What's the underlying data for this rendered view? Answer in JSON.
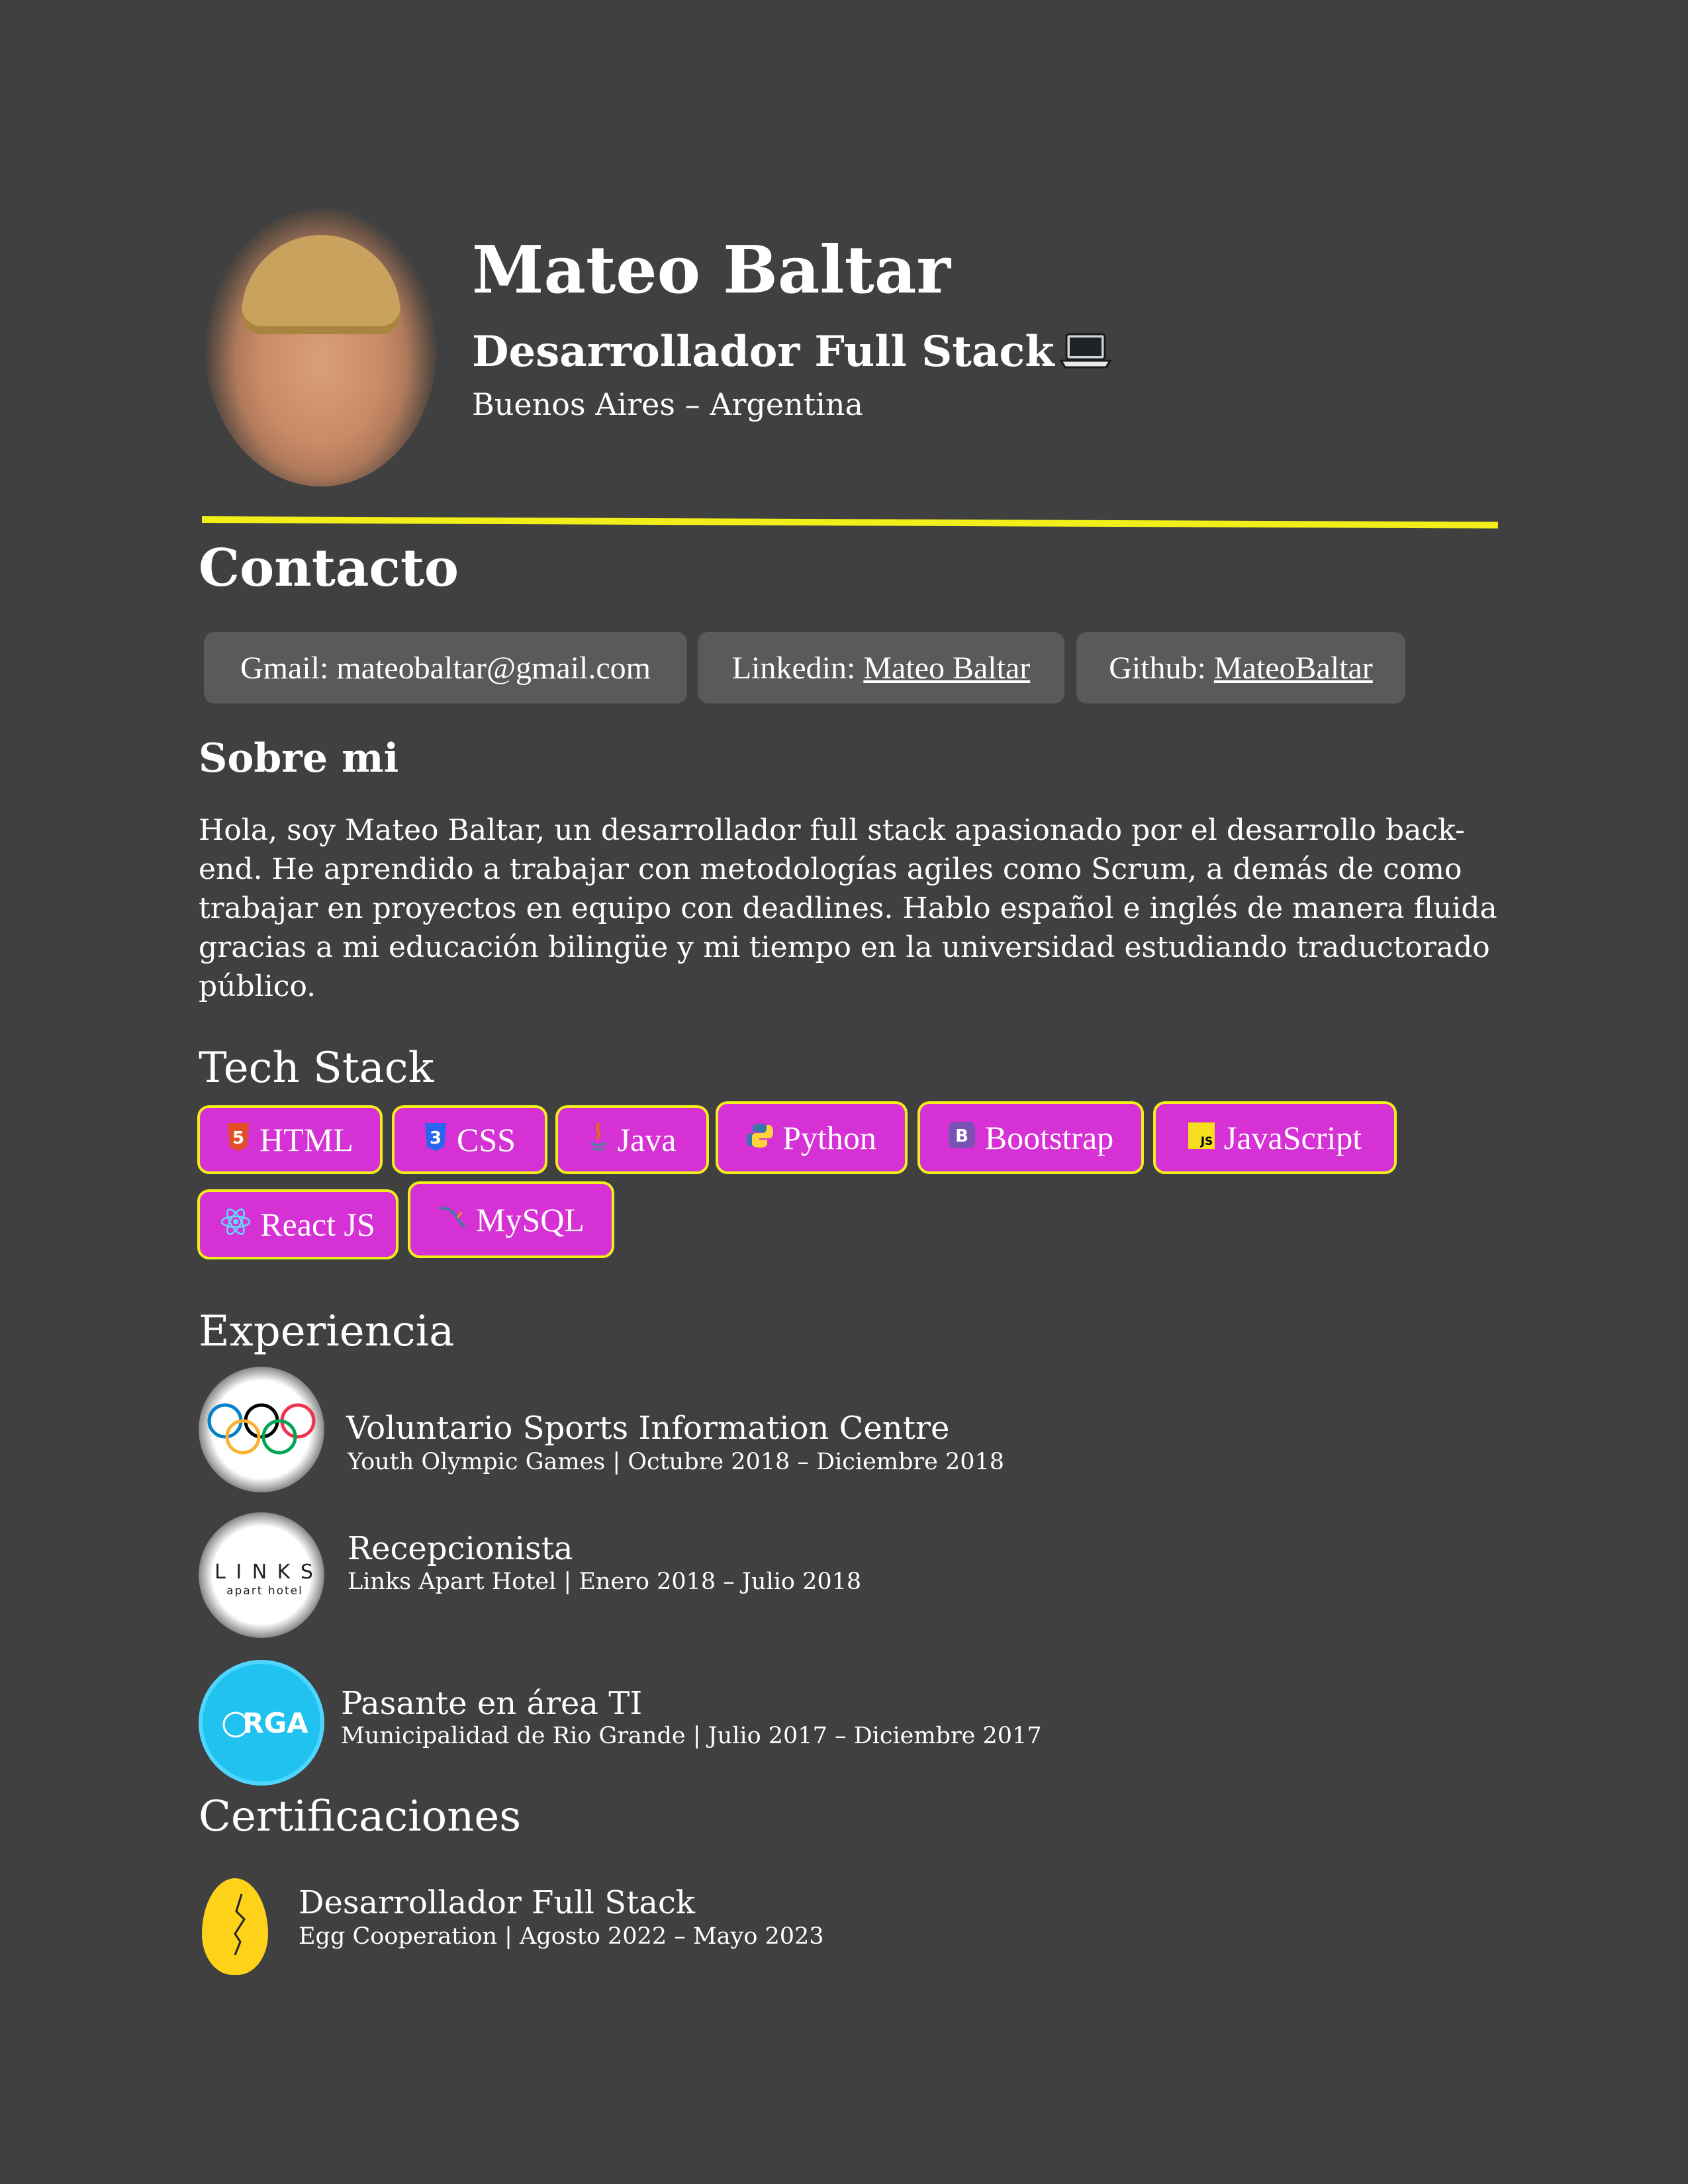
{
  "header": {
    "name": "Mateo Baltar",
    "role": "Desarrollador Full Stack",
    "location": "Buenos Aires – Argentina"
  },
  "contact": {
    "title": "Contacto",
    "items": [
      {
        "label": "Gmail:",
        "value": "mateobaltar@gmail.com",
        "link": false
      },
      {
        "label": "Linkedin:",
        "value": "Mateo Baltar",
        "link": true
      },
      {
        "label": "Github:",
        "value": "MateoBaltar",
        "link": true
      }
    ]
  },
  "about": {
    "title": "Sobre mi",
    "text": "Hola, soy Mateo Baltar, un desarrollador full stack apasionado por el desarrollo back-end. He aprendido a trabajar con metodologías agiles como Scrum, a demás de como trabajar en proyectos en equipo con deadlines. Hablo español e inglés de manera fluida gracias a mi educación bilingüe y mi tiempo en la universidad estudiando traductorado público."
  },
  "tech": {
    "title": "Tech Stack",
    "items": [
      {
        "label": "HTML",
        "icon": "html5-icon"
      },
      {
        "label": "CSS",
        "icon": "css3-icon"
      },
      {
        "label": "Java",
        "icon": "java-icon"
      },
      {
        "label": "Python",
        "icon": "python-icon"
      },
      {
        "label": "Bootstrap",
        "icon": "bootstrap-icon"
      },
      {
        "label": "JavaScript",
        "icon": "javascript-icon"
      },
      {
        "label": "React JS",
        "icon": "react-icon"
      },
      {
        "label": "MySQL",
        "icon": "mysql-icon"
      }
    ],
    "colors": {
      "chip": "#d531d4",
      "border": "#f2ee1a"
    }
  },
  "experience": {
    "title": "Experiencia",
    "items": [
      {
        "title": "Voluntario Sports Information Centre",
        "subtitle": "Youth Olympic Games | Octubre 2018 – Diciembre 2018",
        "logo": "olympic-rings-logo"
      },
      {
        "title": "Recepcionista",
        "subtitle": "Links Apart Hotel | Enero 2018 – Julio 2018",
        "logo": "links-hotel-logo",
        "logo_text": "L I N K S",
        "logo_subtext": "apart hotel"
      },
      {
        "title": "Pasante en área TI",
        "subtitle": "Municipalidad de Rio Grande | Julio 2017 – Diciembre 2017",
        "logo": "rga-logo",
        "logo_text": "RGA"
      }
    ]
  },
  "certifications": {
    "title": "Certificaciones",
    "items": [
      {
        "title": "Desarrollador Full Stack",
        "subtitle": "Egg Cooperation | Agosto 2022 – Mayo 2023",
        "logo": "egg-logo"
      }
    ]
  },
  "colors": {
    "background": "#404040",
    "accent_line": "#f2ee1a",
    "pill": "#5a5a5a"
  }
}
